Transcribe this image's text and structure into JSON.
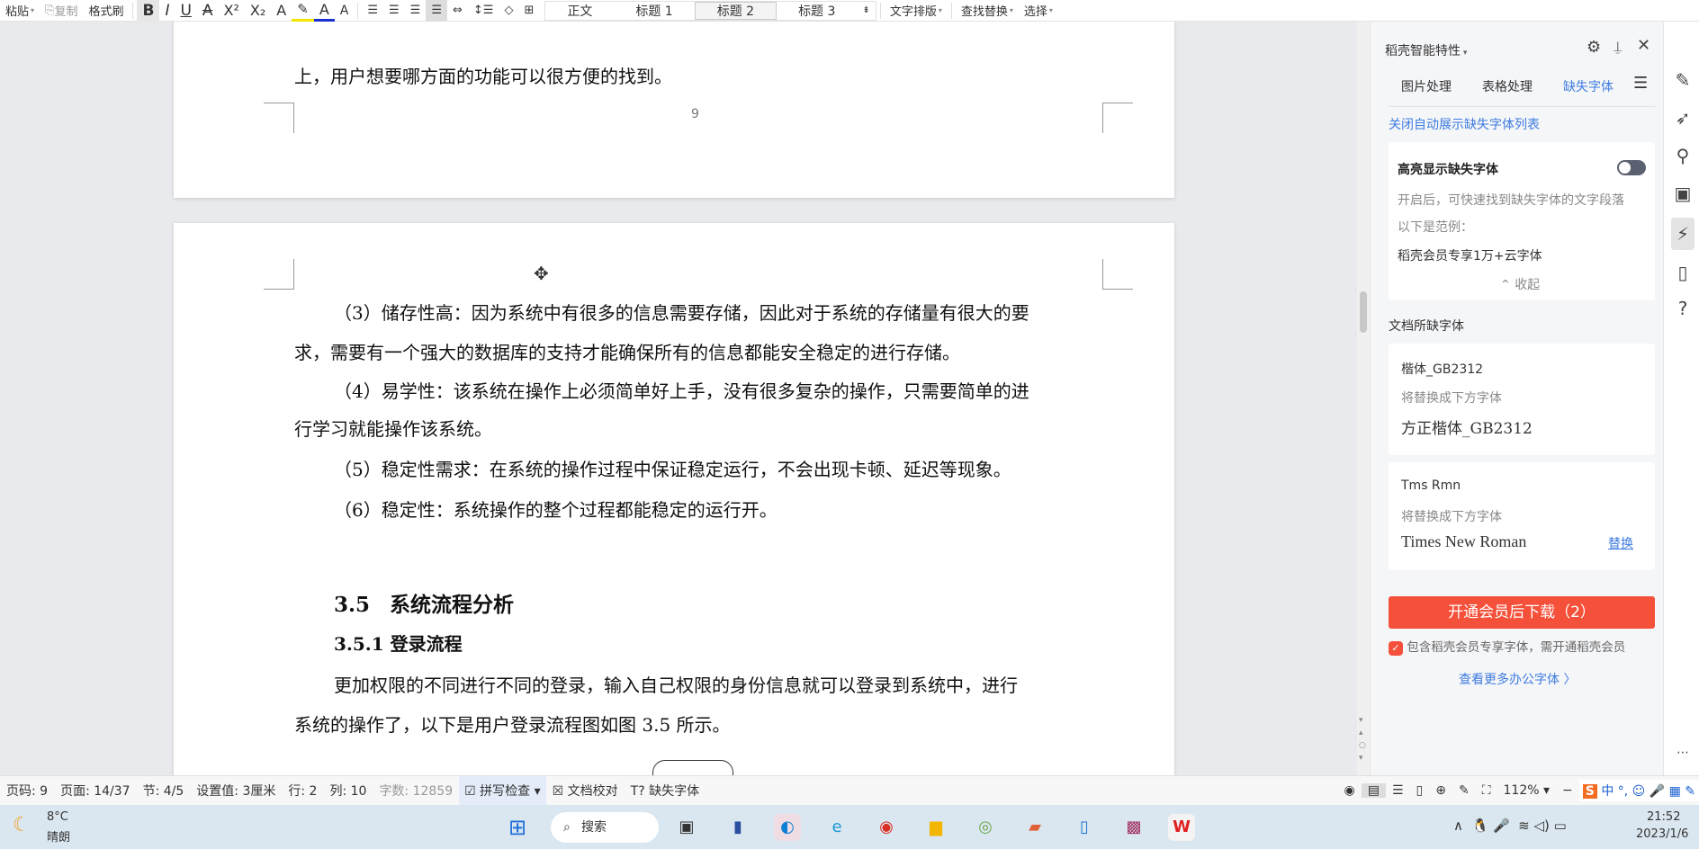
{
  "toolbar": {
    "paste": "粘贴",
    "copy": "复制",
    "format_painter": "格式刷",
    "bold": "B",
    "italic": "I",
    "underline": "U",
    "strike": "A",
    "superscript": "X²",
    "subscript": "X₂",
    "text_effect": "A",
    "highlight": "✎",
    "font_color": "A",
    "char_border": "A",
    "styles": [
      "正文",
      "标题 1",
      "标题 2",
      "标题 3"
    ],
    "selected_style": "标题 2",
    "text_layout": "文字排版",
    "find_replace": "查找替换",
    "select": "选择"
  },
  "document": {
    "page9_tail": "上，用户想要哪方面的功能可以很方便的找到。",
    "page_number": "9",
    "lines": [
      "（3）储存性高：因为系统中有很多的信息需要存储，因此对于系统的存储量有很大的要",
      "求，需要有一个强大的数据库的支持才能确保所有的信息都能安全稳定的进行存储。",
      "（4）易学性：该系统在操作上必须简单好上手，没有很多复杂的操作，只需要简单的进",
      "行学习就能操作该系统。",
      "（5）稳定性需求：在系统的操作过程中保证稳定运行，不会出现卡顿、延迟等现象。",
      "（6）稳定性：系统操作的整个过程都能稳定的运行开。"
    ],
    "heading_num": "3.5",
    "heading": "系统流程分析",
    "subheading": "3.5.1 登录流程",
    "para": [
      "更加权限的不同进行不同的登录，输入自己权限的身份信息就可以登录到系统中，进行",
      "系统的操作了，以下是用户登录流程图如图 3.5 所示。"
    ]
  },
  "panel": {
    "title": "稻壳智能特性",
    "tabs": [
      "图片处理",
      "表格处理",
      "缺失字体"
    ],
    "active_tab": "缺失字体",
    "close_auto": "关闭自动展示缺失字体列表",
    "highlight_title": "高亮显示缺失字体",
    "highlight_on": false,
    "highlight_desc": "开启后，可快速找到缺失字体的文字段落",
    "example_label": "以下是范例：",
    "example_text": "稻壳会员专享1万+云字体",
    "collapse": "收起",
    "missing_header": "文档所缺字体",
    "fonts": [
      {
        "name": "楷体_GB2312",
        "replace_hint": "将替换成下方字体",
        "replacement": "方正楷体_GB2312"
      },
      {
        "name": "Tms Rmn",
        "replace_hint": "将替换成下方字体",
        "replacement": "Times New Roman",
        "action": "替换"
      }
    ],
    "download_button": "开通会员后下载（2）",
    "member_note": "包含稻壳会员专享字体，需开通稻壳会员",
    "more_fonts": "查看更多办公字体 〉",
    "accent": "#f5503a"
  },
  "statusbar": {
    "page_code": "页码: 9",
    "page": "页面: 14/37",
    "section": "节: 4/5",
    "setting": "设置值: 3厘米",
    "row": "行: 2",
    "col": "列: 10",
    "word_count": "字数: 12859",
    "spell_check": "拼写检查",
    "doc_check": "文档校对",
    "missing_font": "缺失字体",
    "zoom": "112%"
  },
  "taskbar": {
    "temp": "8°C",
    "weather": "晴朗",
    "search": "搜索",
    "time": "21:52",
    "date": "2023/1/6",
    "ime": "中"
  }
}
